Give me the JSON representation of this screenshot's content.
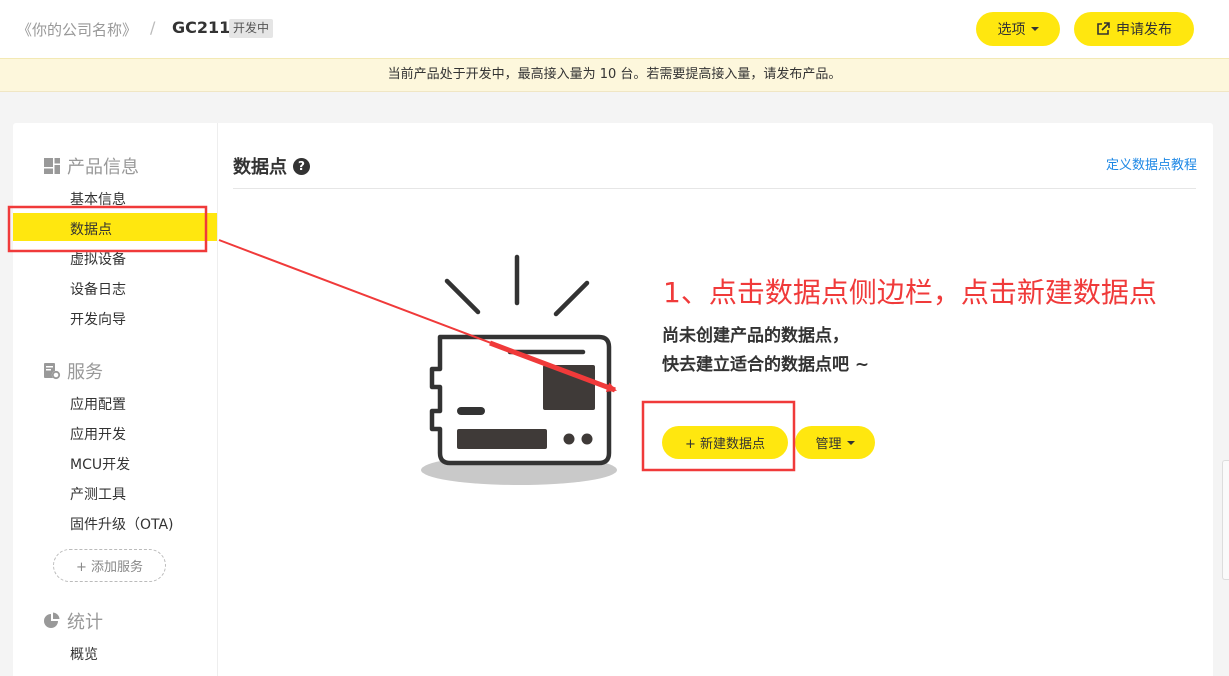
{
  "header": {
    "company": "《你的公司名称》",
    "separator": "/",
    "product": "GC211",
    "status_badge": "开发中",
    "options_label": "选项",
    "publish_label": "申请发布"
  },
  "notice": "当前产品处于开发中，最高接入量为 10 台。若需要提高接入量，请发布产品。",
  "sidebar": {
    "sections": [
      {
        "title": "产品信息",
        "icon": "grid-icon",
        "items": [
          "基本信息",
          "数据点",
          "虚拟设备",
          "设备日志",
          "开发向导"
        ]
      },
      {
        "title": "服务",
        "icon": "service-gear-icon",
        "items": [
          "应用配置",
          "应用开发",
          "MCU开发",
          "产测工具",
          "固件升级（OTA)"
        ]
      },
      {
        "title": "统计",
        "icon": "pie-chart-icon",
        "items": [
          "概览"
        ]
      }
    ],
    "active_item": "数据点",
    "add_service_label": "+ 添加服务"
  },
  "main": {
    "title": "数据点",
    "help_icon": "?",
    "tutorial_link": "定义数据点教程",
    "empty_line1": "尚未创建产品的数据点，",
    "empty_line2": "快去建立适合的数据点吧 ~",
    "new_button": "+ 新建数据点",
    "manage_button": "管理"
  },
  "annotation": {
    "text": "1、点击数据点侧边栏，点击新建数据点",
    "color": "#f03a3a"
  },
  "colors": {
    "accent": "#ffe70f",
    "link": "#1e88e5",
    "annotation": "#f03a3a"
  }
}
